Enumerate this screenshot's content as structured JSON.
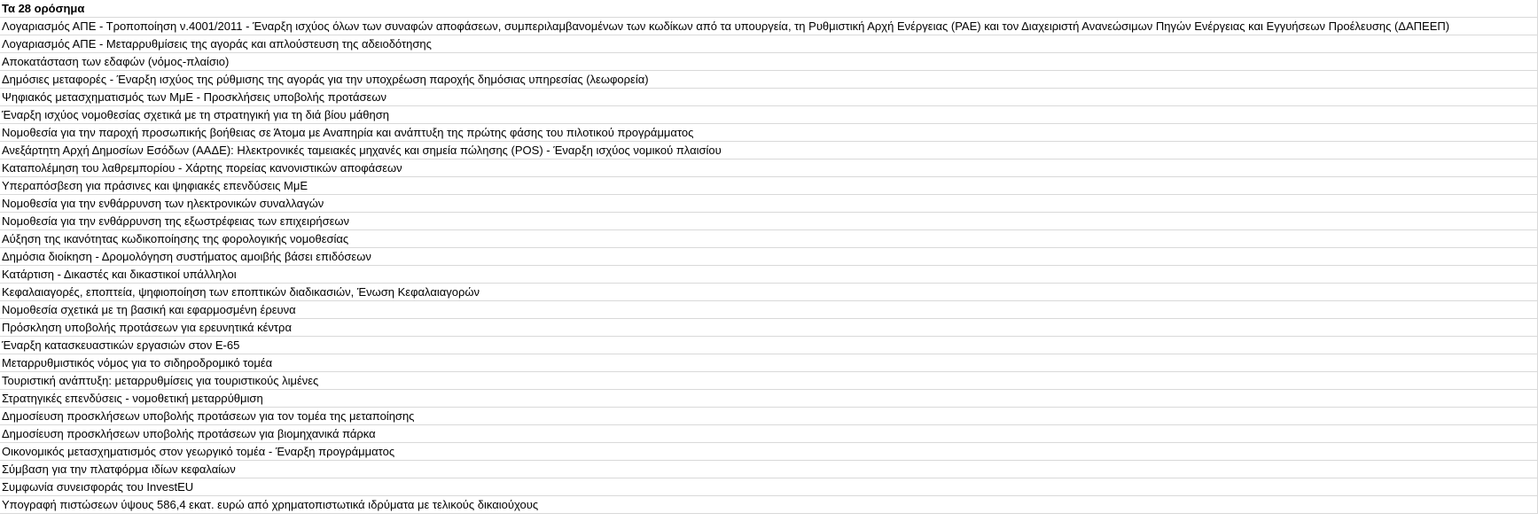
{
  "sheet": {
    "header": "Τα 28 ορόσημα",
    "rows": [
      "Λογαριασμός ΑΠΕ - Τροποποίηση ν.4001/2011 - Έναρξη ισχύος όλων των συναφών αποφάσεων, συμπεριλαμβανομένων των κωδίκων από τα υπουργεία, τη Ρυθμιστική Αρχή Ενέργειας (ΡΑΕ) και τον Διαχειριστή Ανανεώσιμων Πηγών Ενέργειας και Εγγυήσεων Προέλευσης (ΔΑΠΕΕΠ)",
      "Λογαριασμός ΑΠΕ - Μεταρρυθμίσεις της αγοράς και απλούστευση της αδειοδότησης",
      "Αποκατάσταση των εδαφών (νόμος-πλαίσιο)",
      "Δημόσιες μεταφορές - Έναρξη ισχύος της ρύθμισης της αγοράς για την υποχρέωση παροχής δημόσιας υπηρεσίας (λεωφορεία)",
      "Ψηφιακός μετασχηματισμός των ΜμΕ - Προσκλήσεις υποβολής προτάσεων",
      "Έναρξη ισχύος νομοθεσίας σχετικά με τη στρατηγική για τη διά βίου μάθηση",
      "Νομοθεσία για την παροχή προσωπικής βοήθειας σε Άτομα με Αναπηρία και ανάπτυξη της πρώτης φάσης του πιλοτικού προγράμματος",
      "Ανεξάρτητη Αρχή Δημοσίων Εσόδων (ΑΑΔΕ): Ηλεκτρονικές ταμειακές μηχανές και σημεία πώλησης (POS) - Έναρξη ισχύος νομικού πλαισίου",
      "Καταπολέμηση του λαθρεμπορίου - Χάρτης πορείας κανονιστικών αποφάσεων",
      "Υπεραπόσβεση για πράσινες και ψηφιακές επενδύσεις ΜμΕ",
      "Νομοθεσία για την ενθάρρυνση των ηλεκτρονικών συναλλαγών",
      "Νομοθεσία για την ενθάρρυνση της εξωστρέφειας των επιχειρήσεων",
      "Αύξηση της ικανότητας κωδικοποίησης της φορολογικής νομοθεσίας",
      "Δημόσια διοίκηση - Δρομολόγηση συστήματος αμοιβής βάσει επιδόσεων",
      "Κατάρτιση - Δικαστές και δικαστικοί υπάλληλοι",
      "Κεφαλαιαγορές, εποπτεία, ψηφιοποίηση των εποπτικών διαδικασιών, Ένωση Κεφαλαιαγορών",
      " Νομοθεσία σχετικά με τη βασική και εφαρμοσμένη έρευνα",
      "Πρόσκληση υποβολής προτάσεων για ερευνητικά κέντρα",
      "Έναρξη κατασκευαστικών εργασιών στον Ε-65",
      "Μεταρρυθμιστικός νόμος για το σιδηροδρομικό τομέα",
      "Τουριστική ανάπτυξη: μεταρρυθμίσεις για τουριστικούς λιμένες",
      "Στρατηγικές επενδύσεις - νομοθετική μεταρρύθμιση",
      "Δημοσίευση προσκλήσεων υποβολής προτάσεων για τον τομέα της μεταποίησης",
      "Δημοσίευση προσκλήσεων υποβολής προτάσεων για βιομηχανικά πάρκα",
      "Οικονομικός μετασχηματισμός στον γεωργικό τομέα - Έναρξη προγράμματος",
      "Σύμβαση για την πλατφόρμα ιδίων κεφαλαίων",
      "Συμφωνία συνεισφοράς του InvestEU",
      "Υπογραφή πιστώσεων ύψους 586,4 εκατ. ευρώ από χρηματοπιστωτικά ιδρύματα με τελικούς δικαιούχους"
    ]
  }
}
